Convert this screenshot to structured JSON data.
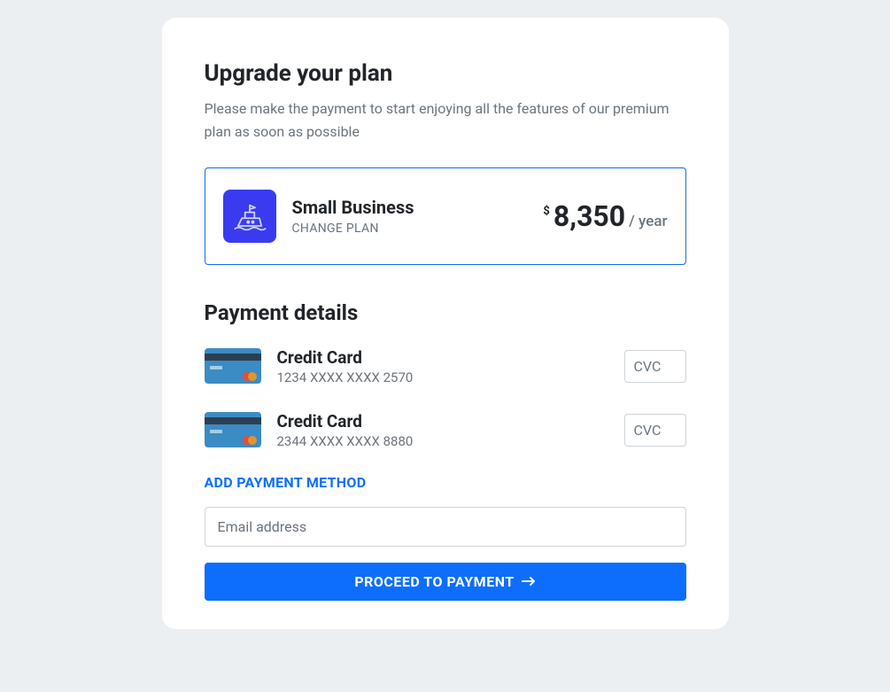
{
  "header": {
    "title": "Upgrade your plan",
    "subtitle": "Please make the payment to start enjoying all the features of our premium plan as soon as possible"
  },
  "plan": {
    "name": "Small Business",
    "change_label": "CHANGE PLAN",
    "currency": "$",
    "amount": "8,350",
    "period": "/ year"
  },
  "payment": {
    "section_title": "Payment details",
    "methods": [
      {
        "label": "Credit Card",
        "number": "1234 XXXX XXXX 2570",
        "cvc_placeholder": "CVC"
      },
      {
        "label": "Credit Card",
        "number": "2344 XXXX XXXX 8880",
        "cvc_placeholder": "CVC"
      }
    ],
    "add_method_label": "ADD PAYMENT METHOD",
    "email_placeholder": "Email address",
    "proceed_label": "PROCEED TO PAYMENT"
  }
}
